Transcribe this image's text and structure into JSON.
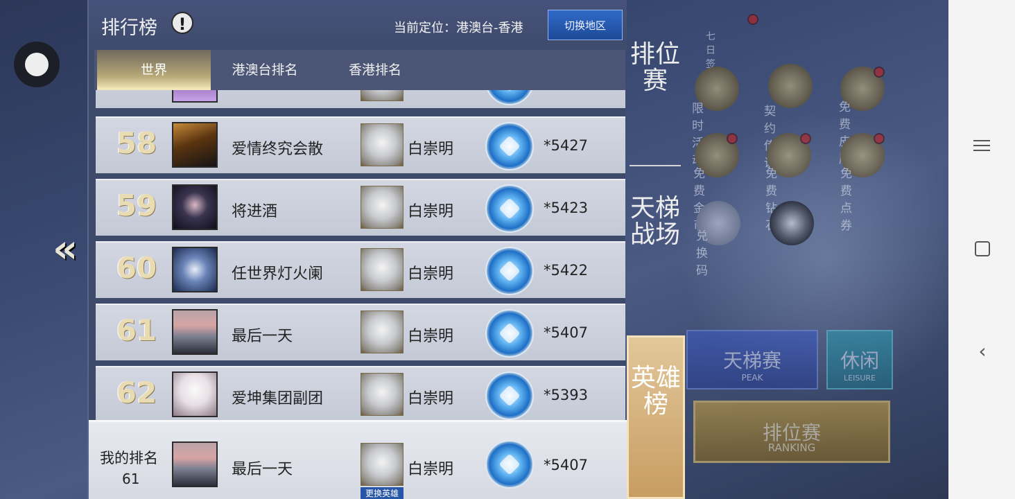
{
  "panel": {
    "title": "排行榜",
    "info_icon": "!",
    "location": "当前定位：港澳台-香港",
    "switch_label": "切换地区"
  },
  "tabs": [
    {
      "label": "世界",
      "active": true
    },
    {
      "label": "港澳台排名",
      "active": false
    },
    {
      "label": "香港排名",
      "active": false
    }
  ],
  "rows": [
    {
      "rank": "58",
      "name": "爱情终究会散",
      "hero": "白崇明",
      "score": "*5427"
    },
    {
      "rank": "59",
      "name": "将进酒",
      "hero": "白崇明",
      "score": "*5423"
    },
    {
      "rank": "60",
      "name": "任世界灯火阑",
      "hero": "白崇明",
      "score": "*5422"
    },
    {
      "rank": "61",
      "name": "最后一天",
      "hero": "白崇明",
      "score": "*5407"
    },
    {
      "rank": "62",
      "name": "爱坤集团副团",
      "hero": "白崇明",
      "score": "*5393"
    }
  ],
  "my_rank": {
    "label": "我的排名",
    "rank": "61",
    "name": "最后一天",
    "hero": "白崇明",
    "change_hero": "更换英雄",
    "score": "*5407"
  },
  "side_tabs": [
    {
      "label": "排位赛",
      "active": false
    },
    {
      "label": "天梯战场",
      "active": false
    },
    {
      "label": "英雄榜",
      "active": true
    }
  ],
  "lobby": {
    "signin": "七日签到",
    "limited_event": "限时活动",
    "contract": "契约传说",
    "free_skin": "免费皮肤",
    "free_gold": "免费金币",
    "free_diamond": "免费钻石",
    "free_point": "免费点券",
    "redeem": "兑换码",
    "ladder": "天梯赛",
    "ladder_en": "PEAK",
    "casual": "休闲",
    "casual_en": "LEISURE",
    "ranked": "排位赛",
    "ranked_en": "RANKING"
  },
  "icons": {
    "back": "double-chevron-left-icon",
    "float_ball": "floating-ball-icon"
  }
}
